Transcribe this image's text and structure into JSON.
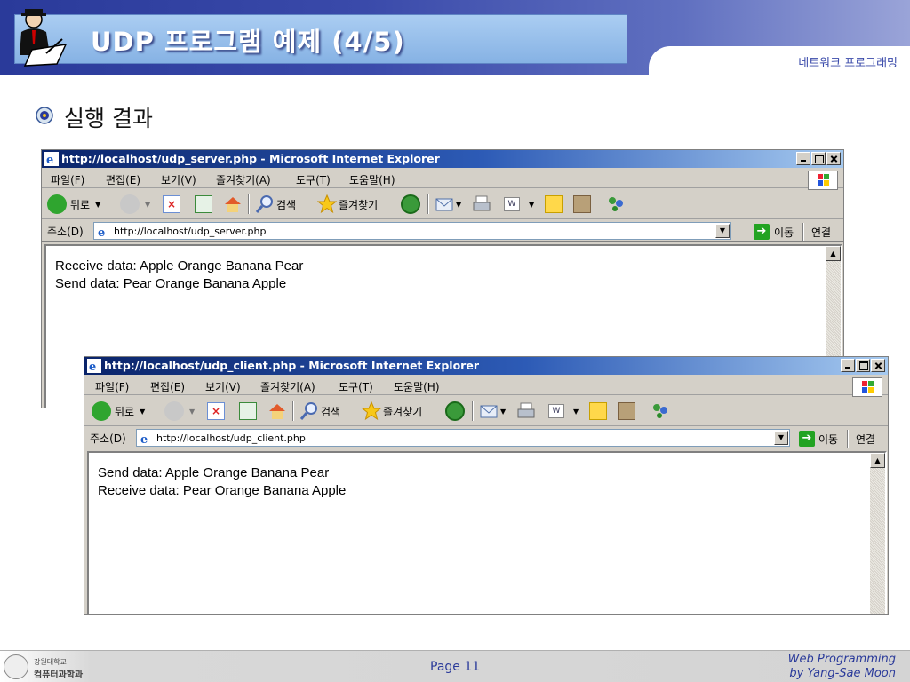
{
  "slide": {
    "title": "UDP 프로그램 예제 (4/5)",
    "subtitle": "네트워크 프로그래밍",
    "bullet": "실행 결과"
  },
  "server_window": {
    "title": "http://localhost/udp_server.php - Microsoft Internet Explorer",
    "menu": [
      "파일(F)",
      "편집(E)",
      "보기(V)",
      "즐겨찾기(A)",
      "도구(T)",
      "도움말(H)"
    ],
    "toolbar": {
      "back": "뒤로",
      "search": "검색",
      "favorites": "즐겨찾기"
    },
    "address_label": "주소(D)",
    "address": "http://localhost/udp_server.php",
    "go": "이동",
    "links": "연결",
    "lines": [
      "Receive data: Apple Orange Banana Pear",
      "Send data: Pear Orange Banana Apple"
    ]
  },
  "client_window": {
    "title": "http://localhost/udp_client.php - Microsoft Internet Explorer",
    "menu": [
      "파일(F)",
      "편집(E)",
      "보기(V)",
      "즐겨찾기(A)",
      "도구(T)",
      "도움말(H)"
    ],
    "toolbar": {
      "back": "뒤로",
      "search": "검색",
      "favorites": "즐겨찾기"
    },
    "address_label": "주소(D)",
    "address": "http://localhost/udp_client.php",
    "go": "이동",
    "links": "연결",
    "lines": [
      "Send data: Apple Orange Banana Pear",
      "Receive data: Pear Orange Banana Apple"
    ]
  },
  "footer": {
    "school": "강원대학교",
    "department": "컴퓨터과학과",
    "page": "Page 11",
    "credit_line1": "Web Programming",
    "credit_line2": "by Yang-Sae Moon"
  },
  "colors": {
    "header": "#2a3a9a",
    "title_box": "#9cc2ee",
    "ie_titlebar": "#0a246a",
    "accent": "#2a3a9a"
  }
}
